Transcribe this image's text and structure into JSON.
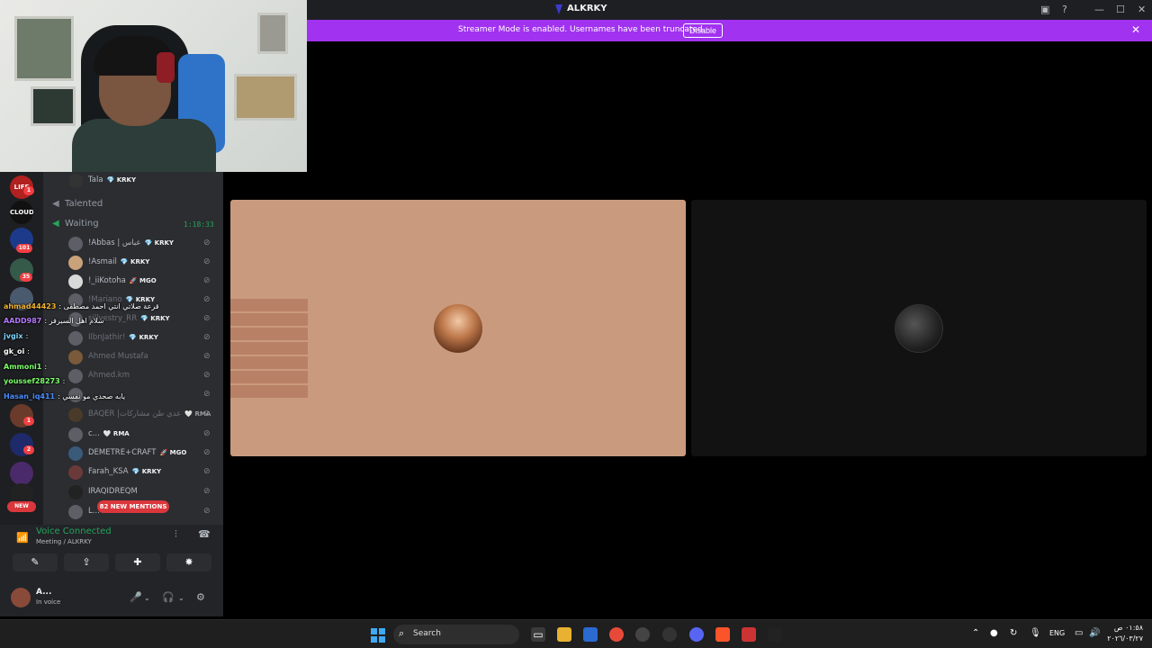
{
  "window": {
    "title": "ALKRKY",
    "buttons": {
      "inbox": "▣",
      "help": "?",
      "minimize": "—",
      "maximize": "☐",
      "close": "✕"
    }
  },
  "banner": {
    "text": "Streamer Mode is enabled. Usernames have been truncated.",
    "button": "Disable",
    "close": "✕"
  },
  "servers": [
    {
      "label": "LIFE",
      "badge": "1"
    },
    {
      "label": "CLOUD",
      "badge": ""
    },
    {
      "label": "",
      "badge": "101"
    },
    {
      "label": "",
      "badge": "35"
    },
    {
      "label": "",
      "badge": ""
    },
    {
      "label": "",
      "badge": "1"
    },
    {
      "label": "",
      "badge": "2"
    },
    {
      "label": "",
      "badge": ""
    },
    {
      "label": "",
      "badge": ""
    }
  ],
  "servers_new": "NEW",
  "channels": {
    "top_member": {
      "name": "Tala",
      "role": "💎 KRKY"
    },
    "talented": "Talented",
    "waiting": "Waiting",
    "timer": "1:18:33",
    "members": [
      {
        "name": "!Abbas | عباس",
        "role": "💎 KRKY",
        "dim": false
      },
      {
        "name": "!Asmail",
        "role": "💎 KRKY",
        "dim": false
      },
      {
        "name": "!_iiKotoha",
        "role": "🚀 MGO",
        "dim": false
      },
      {
        "name": "!Mariano",
        "role": "💎 KRKY",
        "dim": true
      },
      {
        "name": "sillvestry_RR",
        "role": "💎 KRKY",
        "dim": true
      },
      {
        "name": "IlbnJathir!",
        "role": "💎 KRKY",
        "dim": true
      },
      {
        "name": "Ahmed Mustafa",
        "role": "",
        "dim": true
      },
      {
        "name": "Ahmed.km",
        "role": "",
        "dim": true
      },
      {
        "name": "",
        "role": "",
        "dim": true
      },
      {
        "name": "BAQER |عدي طن مشاركات",
        "role": "🤍 RMA",
        "dim": true
      },
      {
        "name": "c...",
        "role": "🤍 RMA",
        "dim": false
      },
      {
        "name": "DEMETRE+CRAFT",
        "role": "🚀 MGO",
        "dim": false
      },
      {
        "name": "Farah_KSA",
        "role": "💎 KRKY",
        "dim": false
      },
      {
        "name": "IRAQIDREQM",
        "role": "",
        "dim": false
      },
      {
        "name": "L...",
        "role": "",
        "dim": false
      }
    ],
    "mentions": "82 NEW MENTIONS"
  },
  "chat_overlay": [
    {
      "user": "ahmad44423",
      "color": "#f0b232",
      "msg": ": قرعة صلاتي انتي احمد مصطفى"
    },
    {
      "user": "AADD987",
      "color": "#b678ff",
      "msg": ": سلام اهل السيرفر"
    },
    {
      "user": "jvgix",
      "color": "#7dd3fc",
      "msg": ":"
    },
    {
      "user": "gk_oi",
      "color": "#ffffff",
      "msg": ":"
    },
    {
      "user": "Ammoni1",
      "color": "#7cff6b",
      "msg": ":"
    },
    {
      "user": "youssef28273",
      "color": "#7cff6b",
      "msg": ":"
    },
    {
      "user": "Hasan_iq411",
      "color": "#4a8cff",
      "msg": ": يابه صحدي مو نفسي"
    }
  ],
  "voice": {
    "status": "Voice Connected",
    "channel": "Meeting / ALKRKY",
    "buttons": [
      "✎",
      "⇪",
      "✚",
      "✸"
    ],
    "user_name": "A...",
    "user_status": "In voice"
  },
  "taskbar": {
    "search": "Search",
    "lang": "ENG",
    "time": "٠١:٥٨ ص",
    "date": "٢٠٢٦/٠٣/٢٧"
  }
}
